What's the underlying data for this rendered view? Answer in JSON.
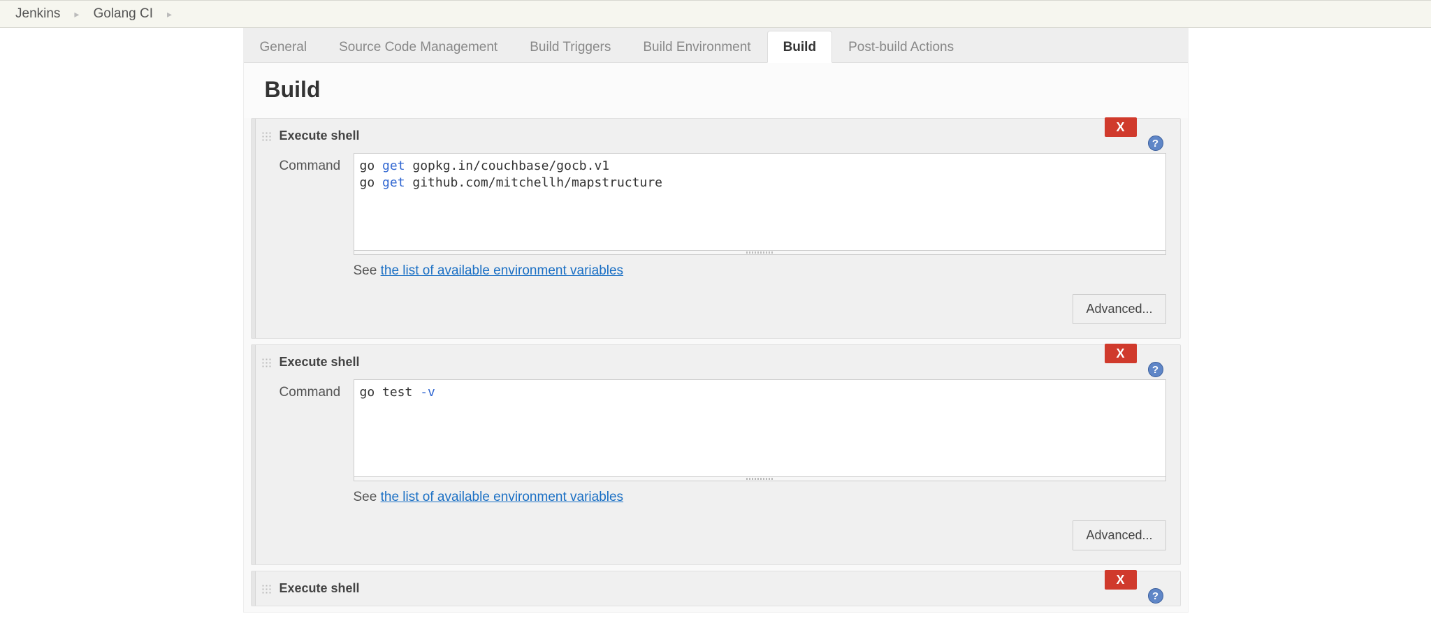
{
  "breadcrumb": {
    "items": [
      "Jenkins",
      "Golang CI"
    ]
  },
  "tabs": {
    "items": [
      {
        "label": "General",
        "active": false
      },
      {
        "label": "Source Code Management",
        "active": false
      },
      {
        "label": "Build Triggers",
        "active": false
      },
      {
        "label": "Build Environment",
        "active": false
      },
      {
        "label": "Build",
        "active": true
      },
      {
        "label": "Post-build Actions",
        "active": false
      }
    ]
  },
  "section": {
    "title": "Build"
  },
  "env_hint": {
    "prefix": "See ",
    "link": "the list of available environment variables"
  },
  "labels": {
    "command": "Command",
    "advanced": "Advanced...",
    "delete": "X",
    "help": "?"
  },
  "steps": [
    {
      "title": "Execute shell",
      "command_tokens": [
        {
          "t": "go ",
          "k": false
        },
        {
          "t": "get",
          "k": true
        },
        {
          "t": " gopkg.in/couchbase/gocb.v1\n",
          "k": false
        },
        {
          "t": "go ",
          "k": false
        },
        {
          "t": "get",
          "k": true
        },
        {
          "t": " github.com/mitchellh/mapstructure",
          "k": false
        }
      ]
    },
    {
      "title": "Execute shell",
      "command_tokens": [
        {
          "t": "go test ",
          "k": false
        },
        {
          "t": "-v",
          "k": true
        }
      ]
    },
    {
      "title": "Execute shell",
      "command_tokens": []
    }
  ]
}
